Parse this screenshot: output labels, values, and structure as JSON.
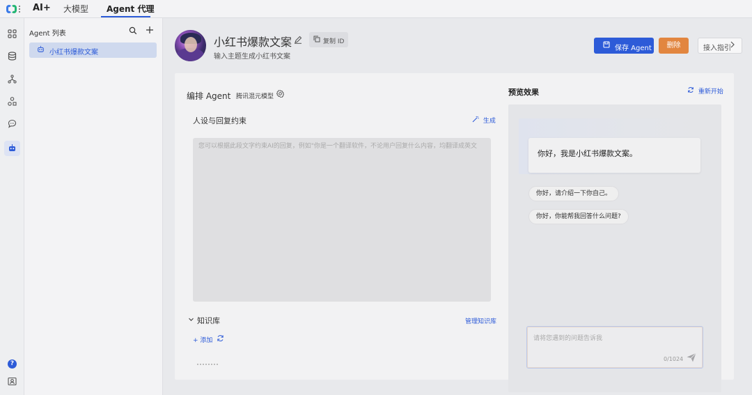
{
  "topbar": {
    "brand": "AI+",
    "tabs": [
      {
        "label": "大模型",
        "active": false
      },
      {
        "label": "Agent 代理",
        "active": true
      }
    ]
  },
  "rail": {
    "icons": [
      "grid-icon",
      "database-icon",
      "workflow-icon",
      "shapes-icon",
      "chat-icon",
      "robot-icon"
    ],
    "bottom": [
      "help-icon",
      "profile-icon"
    ],
    "active_icon": "robot-icon",
    "help_glyph": "?"
  },
  "agent_list": {
    "title": "Agent 列表",
    "items": [
      {
        "label": "小红书爆款文案",
        "selected": true
      }
    ]
  },
  "agent": {
    "name": "小红书爆款文案",
    "description": "输入主题生成小红书文案",
    "copy_id_label": "复制 ID"
  },
  "actions": {
    "save_label": "保存 Agent",
    "delete_label": "删除",
    "guide_label": "接入指引"
  },
  "orchestration": {
    "title": "编排 Agent",
    "model_name": "腾讯混元模型",
    "persona": {
      "title": "人设与回复约束",
      "generate_label": "生成",
      "placeholder": "您可以根据此段文字约束AI的回复，例如\"你是一个翻译软件，不论用户回复什么内容，均翻译成英文"
    },
    "knowledge": {
      "title": "知识库",
      "manage_label": "管理知识库",
      "add_label": "+ 添加"
    }
  },
  "preview": {
    "title": "预览效果",
    "restart_label": "重新开始",
    "greeting": "你好，我是小红书爆款文案。",
    "suggestions": [
      "你好，请介绍一下你自己。",
      "你好，你能帮我回答什么问题?"
    ],
    "input_placeholder": "请将您遇到的问题告诉我",
    "char_count": "0/1024"
  },
  "colors": {
    "accent": "#2d5bd8",
    "danger": "#e28640"
  }
}
